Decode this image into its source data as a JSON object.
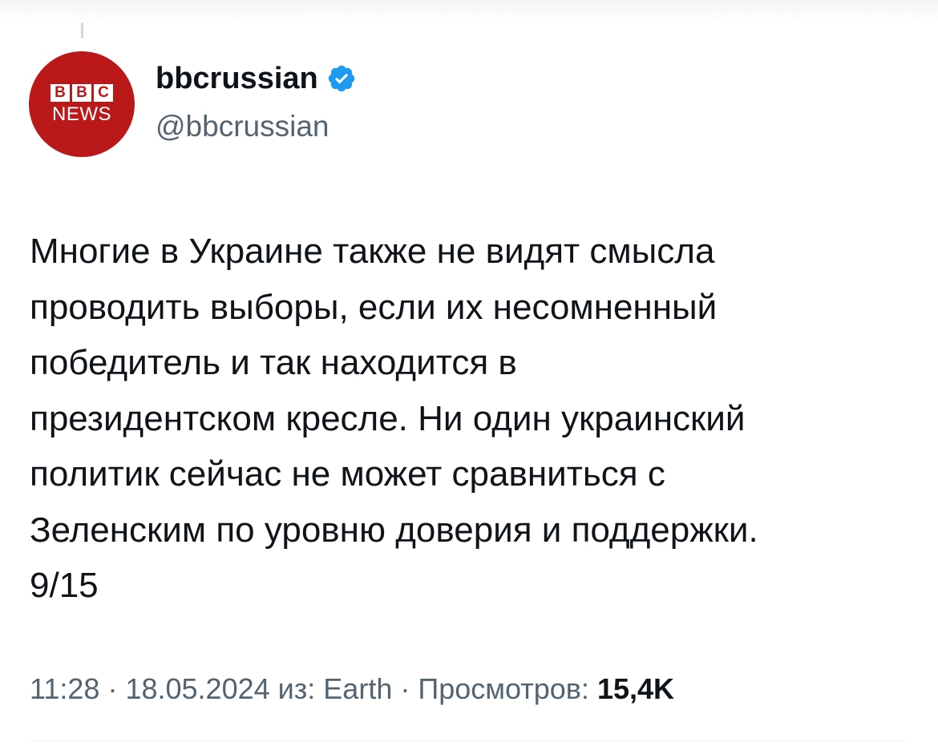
{
  "author": {
    "avatar_logo_letters": [
      "B",
      "B",
      "C"
    ],
    "avatar_logo_word": "NEWS",
    "display_name": "bbcrussian",
    "handle": "@bbcrussian",
    "verified_icon": "verified-badge-icon",
    "brand_color": "#bb1919",
    "verified_color": "#1d9bf0"
  },
  "tweet": {
    "text": "Многие в Украине также не видят смысла\nпроводить выборы, если их несомненный\nпобедитель и так находится в\nпрезидентском кресле. Ни один украинский\nполитик сейчас не может сравниться с\nЗеленским по уровню доверия и поддержки.\n9/15"
  },
  "meta": {
    "time": "11:28",
    "separator": "·",
    "date": "18.05.2024",
    "source_prefix": "из:",
    "source": "Earth",
    "views_label": "Просмотров:",
    "views_count": "15,4K"
  }
}
